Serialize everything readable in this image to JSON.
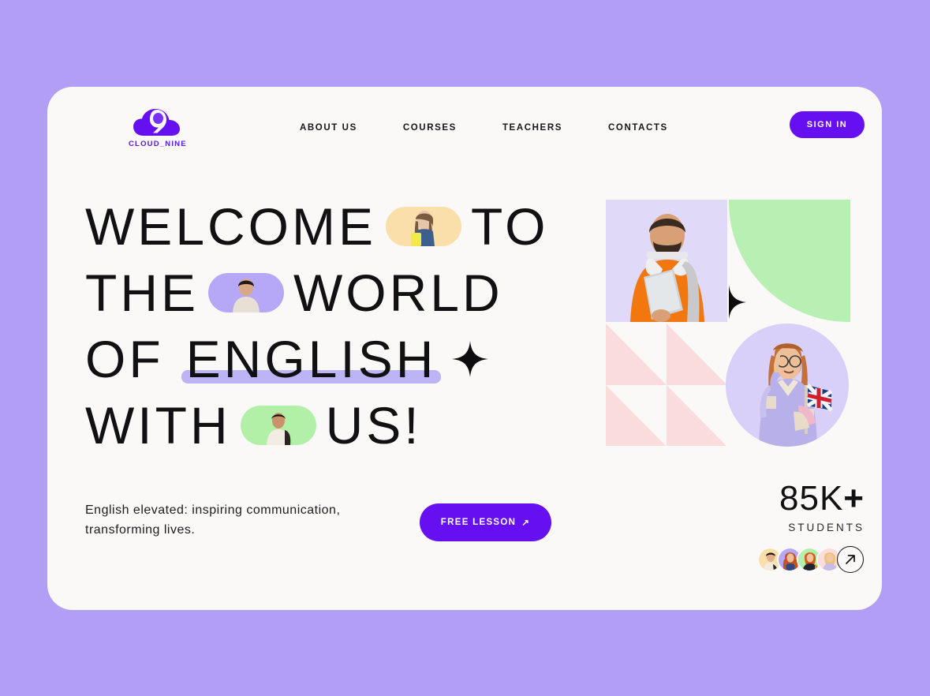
{
  "brand": {
    "name": "CLOUD_NINE",
    "logo_icon": "cloud-nine-logo-icon",
    "color": "#5b17e0"
  },
  "theme": {
    "page_bg": "#b39ef5",
    "card_bg": "#faf9f7",
    "accent_purple": "#6610f2",
    "lavender": "#bdb4f5",
    "mint": "#b8f0b4",
    "peach": "#fadfab",
    "pink": "#fbdcdc",
    "ink": "#111114"
  },
  "nav": {
    "items": [
      {
        "label": "ABOUT US"
      },
      {
        "label": "COURSES"
      },
      {
        "label": "TEACHERS"
      },
      {
        "label": "CONTACTS"
      }
    ],
    "signin_label": "SIGN IN"
  },
  "hero": {
    "line1": {
      "a": "WELCOME",
      "b": "TO",
      "pill": "student-woman-phone-photo"
    },
    "line2": {
      "a": "THE",
      "b": "WORLD",
      "pill": "student-man-tshirt-photo"
    },
    "line3": {
      "a": "OF",
      "emphasis": "ENGLISH",
      "star": "sparkle-star-icon"
    },
    "line4": {
      "a": "WITH",
      "b": "US!",
      "pill": "student-woman-backpack-photo"
    },
    "tagline": "English elevated: inspiring communication, transforming lives.",
    "cta_label": "FREE LESSON",
    "cta_arrow": "↗"
  },
  "collage": {
    "top_left": "man-orange-sweater-laptop-photo",
    "top_right": "green-quarter-circle-shape",
    "top_right_star": "sparkle-star-icon",
    "bottom_left": "pink-triangle-pattern",
    "bottom_right": "woman-uk-flag-photo"
  },
  "stats": {
    "value_num": "85K",
    "value_plus": "+",
    "label": "STUDENTS",
    "avatars": [
      {
        "name": "avatar-student-1"
      },
      {
        "name": "avatar-student-2"
      },
      {
        "name": "avatar-student-3"
      },
      {
        "name": "avatar-student-4"
      }
    ],
    "more_arrow": "↗"
  }
}
